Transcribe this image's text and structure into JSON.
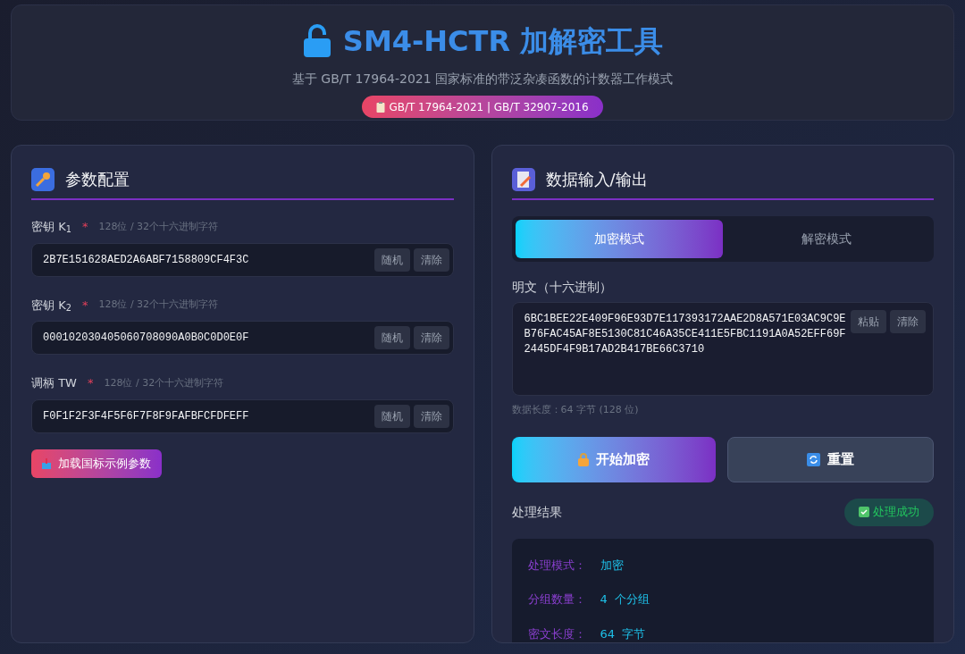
{
  "header": {
    "title": "SM4-HCTR 加解密工具",
    "subtitle": "基于 GB/T 17964-2021 国家标准的带泛杂凑函数的计数器工作模式",
    "badge": "GB/T 17964-2021 | GB/T 32907-2016"
  },
  "params": {
    "title": "参数配置",
    "fields": [
      {
        "label": "密钥 K$_{1}$",
        "required": "*",
        "hint": "128位 / 32个十六进制字符",
        "value": "2B7E151628AED2A6ABF7158809CF4F3C",
        "buttons": [
          "随机",
          "清除"
        ]
      },
      {
        "label": "密钥 K$_{2}$",
        "required": "*",
        "hint": "128位 / 32个十六进制字符",
        "value": "000102030405060708090A0B0C0D0E0F",
        "buttons": [
          "随机",
          "清除"
        ]
      },
      {
        "label": "调柄 TW",
        "required": "*",
        "hint": "128位 / 32个十六进制字符",
        "value": "F0F1F2F3F4F5F6F7F8F9FAFBFCFDFEFF",
        "buttons": [
          "随机",
          "清除"
        ]
      }
    ],
    "load_button": "加载国标示例参数"
  },
  "io": {
    "title": "数据输入/输出",
    "modes": [
      {
        "label": "加密模式",
        "selected": true
      },
      {
        "label": "解密模式",
        "selected": false
      }
    ],
    "input_label": "明文（十六进制）",
    "input_value": "6BC1BEE22E409F96E93D7E117393172AAE2D8A571E03AC9C9EB76FAC45AF8E5130C81C46A35CE411E5FBC1191A0A52EFF69F2445DF4F9B17AD2B417BE66C3710",
    "input_buttons": [
      "粘贴",
      "清除"
    ],
    "data_length": "数据长度：64 字节 (128 位)",
    "start_button": "开始加密",
    "reset_button": "重置",
    "result_title": "处理结果",
    "status": "处理成功",
    "results": [
      {
        "label": "处理模式：",
        "value": "加密"
      },
      {
        "label": "分组数量：",
        "value": "4  个分组"
      },
      {
        "label": "密文长度：",
        "value": "64  字节"
      }
    ]
  }
}
